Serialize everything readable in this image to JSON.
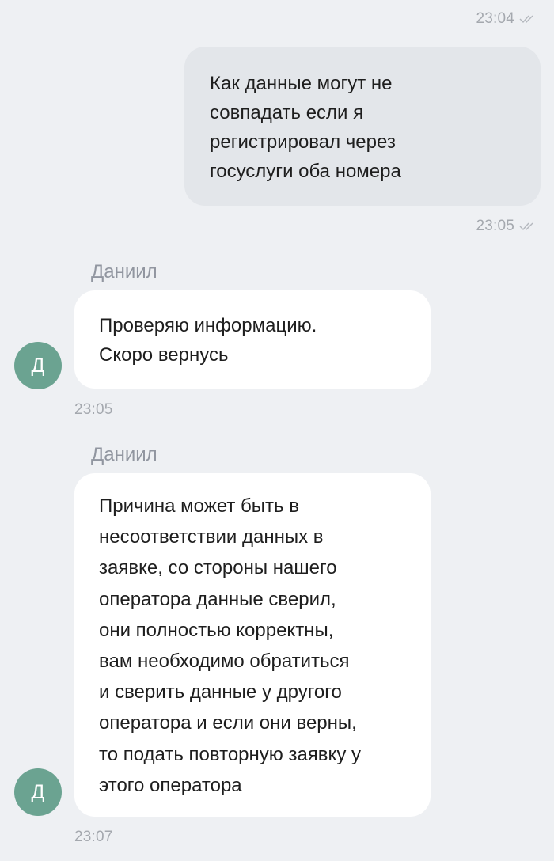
{
  "chat": {
    "messages": [
      {
        "direction": "outgoing",
        "time": "23:04",
        "status_icon": "double-check-icon"
      },
      {
        "direction": "outgoing",
        "text": "Как данные могут не\nсовпадать если я\nрегистрировал через\nгосуслуги оба номера",
        "time": "23:05",
        "status_icon": "double-check-icon"
      },
      {
        "direction": "incoming",
        "sender": "Даниил",
        "avatar_letter": "Д",
        "text": "Проверяю информацию.\nСкоро вернусь",
        "time": "23:05"
      },
      {
        "direction": "incoming",
        "sender": "Даниил",
        "avatar_letter": "Д",
        "text": "Причина может быть в\nнесоответствии данных в\nзаявке, со стороны нашего\nоператора данные сверил,\nони полностью корректны,\nвам необходимо обратиться\nи сверить данные у другого\nоператора и если они верны,\nто подать повторную заявку у\nэтого оператора",
        "time": "23:07"
      }
    ]
  },
  "colors": {
    "background": "#eef0f3",
    "outgoing_bubble": "#e3e6ea",
    "incoming_bubble": "#ffffff",
    "avatar": "#6ba391",
    "meta_text": "#a4a8ae"
  }
}
